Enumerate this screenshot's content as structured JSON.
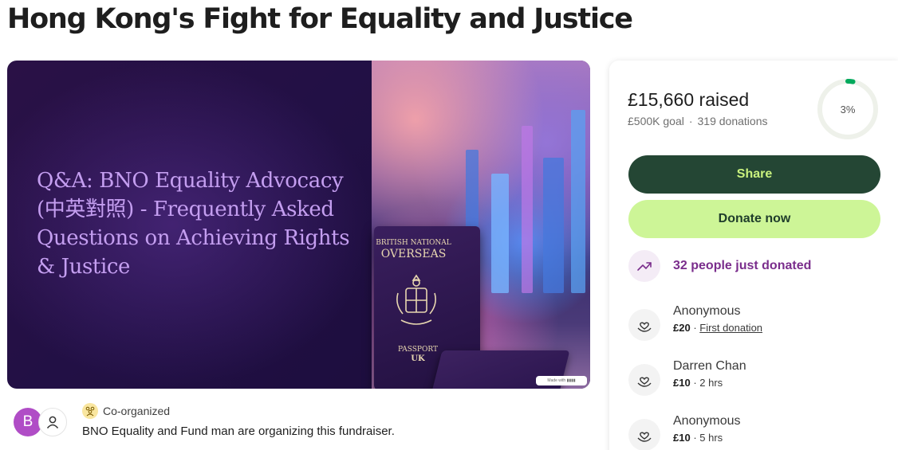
{
  "page": {
    "title": "Hong Kong's Fight for Equality and Justice"
  },
  "hero": {
    "headline": "Q&A: BNO Equality Advocacy (中英對照) - Frequently Asked Questions on Achieving Rights & Justice",
    "passport_label_small": "BRITISH NATIONAL",
    "passport_label_big": "OVERSEAS",
    "passport_foot_small": "PASSPORT",
    "passport_foot_big": "UK",
    "made_with": "Made with ▮▮▮▮"
  },
  "organizer": {
    "avatar_letter": "B",
    "co_organized_label": "Co-organized",
    "description": "BNO Equality and Fund man are organizing this fundraiser."
  },
  "donation_card": {
    "raised": "£15,660 raised",
    "goal": "£500K goal",
    "donations": "319 donations",
    "progress_label": "3%",
    "progress_fraction": 0.03,
    "share_label": "Share",
    "donate_label": "Donate now",
    "recent_activity": "32 people just donated",
    "donors": [
      {
        "name": "Anonymous",
        "amount": "£20",
        "note": "First donation"
      },
      {
        "name": "Darren Chan",
        "amount": "£10",
        "note": "2 hrs"
      },
      {
        "name": "Anonymous",
        "amount": "£10",
        "note": "5 hrs"
      }
    ]
  },
  "colors": {
    "share_bg": "#244634",
    "share_text": "#c9f27e",
    "donate_bg": "#cdf597",
    "progress": "#02a95c",
    "recent_text": "#7a2d8c",
    "avatar_b": "#b04dc6"
  }
}
